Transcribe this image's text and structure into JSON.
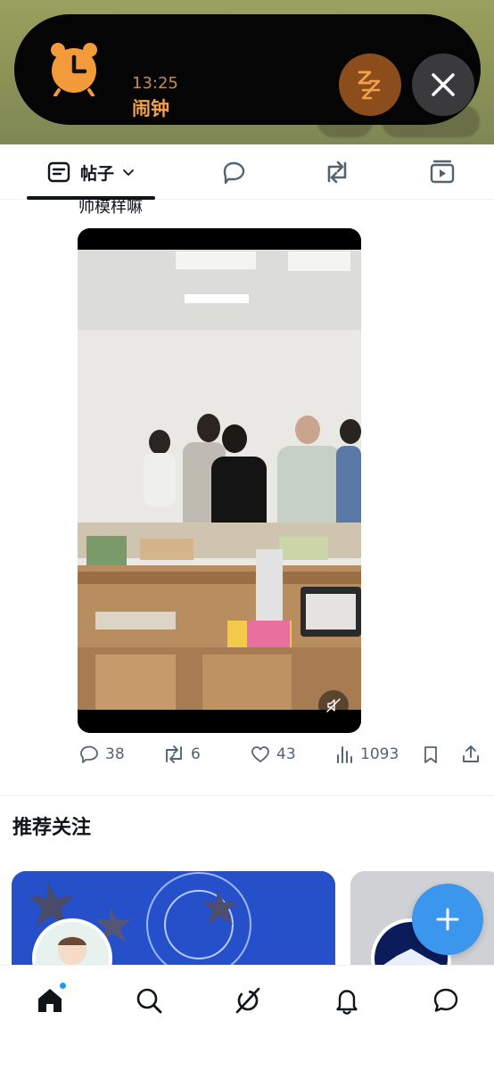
{
  "alarm": {
    "time": "13:25",
    "title": "闹钟",
    "snooze_icon": "zzz-icon",
    "stop_icon": "close-icon",
    "accent": "#f5a04b"
  },
  "tabs": [
    {
      "label": "帖子",
      "icon": "post-icon",
      "selected": true
    },
    {
      "label": "",
      "icon": "reply-icon"
    },
    {
      "label": "",
      "icon": "repost-icon"
    },
    {
      "label": "",
      "icon": "video-icon"
    }
  ],
  "post": {
    "text_fragment": "帅模样嘛",
    "actions": {
      "replies": "38",
      "reposts": "6",
      "likes": "43",
      "views": "1093"
    }
  },
  "recommended": {
    "title": "推荐关注"
  },
  "bottom_nav": [
    "home",
    "search",
    "grok",
    "notifications",
    "messages"
  ],
  "colors": {
    "brand": "#1d9bf0",
    "fab": "#3b96ee",
    "text": "#0f1419",
    "muted": "#536471"
  }
}
